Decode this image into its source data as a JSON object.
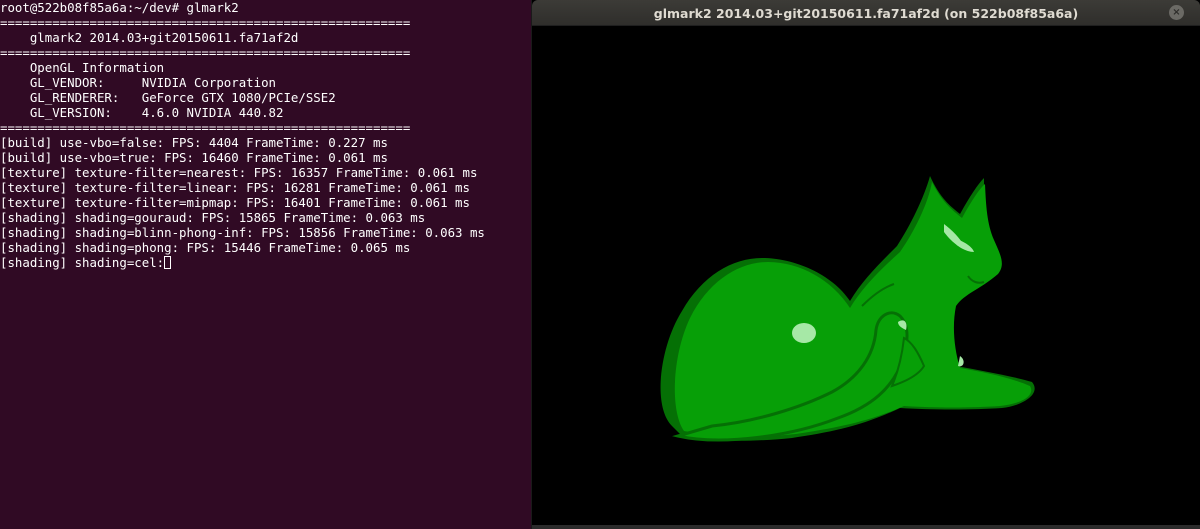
{
  "terminal": {
    "lines": [
      "root@522b08f85a6a:~/dev# glmark2",
      "=======================================================",
      "    glmark2 2014.03+git20150611.fa71af2d",
      "=======================================================",
      "    OpenGL Information",
      "    GL_VENDOR:     NVIDIA Corporation",
      "    GL_RENDERER:   GeForce GTX 1080/PCIe/SSE2",
      "    GL_VERSION:    4.6.0 NVIDIA 440.82",
      "=======================================================",
      "[build] use-vbo=false: FPS: 4404 FrameTime: 0.227 ms",
      "[build] use-vbo=true: FPS: 16460 FrameTime: 0.061 ms",
      "[texture] texture-filter=nearest: FPS: 16357 FrameTime: 0.061 ms",
      "[texture] texture-filter=linear: FPS: 16281 FrameTime: 0.061 ms",
      "[texture] texture-filter=mipmap: FPS: 16401 FrameTime: 0.061 ms",
      "[shading] shading=gouraud: FPS: 15865 FrameTime: 0.063 ms",
      "[shading] shading=blinn-phong-inf: FPS: 15856 FrameTime: 0.063 ms",
      "[shading] shading=phong: FPS: 15446 FrameTime: 0.065 ms",
      "[shading] shading=cel:"
    ],
    "colors": {
      "background": "#300a24",
      "text": "#ffffff"
    }
  },
  "window": {
    "title": "glmark2 2014.03+git20150611.fa71af2d (on 522b08f85a6a)",
    "close_icon": "×",
    "render_colors": {
      "base": "#079f07",
      "shadow": "#057005",
      "highlight": "#a6e8a6"
    }
  }
}
